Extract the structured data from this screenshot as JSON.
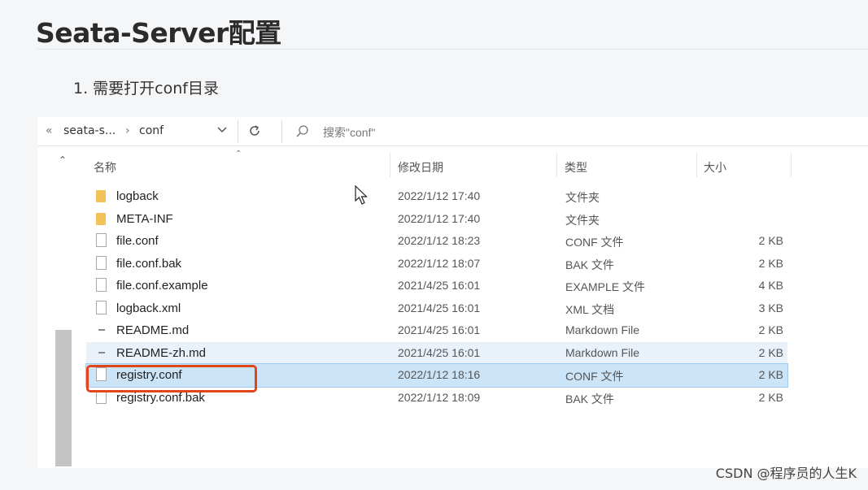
{
  "slide": {
    "title": "Seata-Server配置",
    "step": "1. 需要打开conf目录"
  },
  "explorer": {
    "breadcrumb": {
      "overflow": "«",
      "parent": "seata-s...",
      "separator": "›",
      "current": "conf"
    },
    "search": {
      "placeholder": "搜索\"conf\""
    },
    "columns": {
      "name": "名称",
      "date": "修改日期",
      "type": "类型",
      "size": "大小"
    },
    "files": [
      {
        "name": "logback",
        "date": "2022/1/12 17:40",
        "type": "文件夹",
        "size": "",
        "icon": "folder"
      },
      {
        "name": "META-INF",
        "date": "2022/1/12 17:40",
        "type": "文件夹",
        "size": "",
        "icon": "folder"
      },
      {
        "name": "file.conf",
        "date": "2022/1/12 18:23",
        "type": "CONF 文件",
        "size": "2 KB",
        "icon": "doc"
      },
      {
        "name": "file.conf.bak",
        "date": "2022/1/12 18:07",
        "type": "BAK 文件",
        "size": "2 KB",
        "icon": "doc"
      },
      {
        "name": "file.conf.example",
        "date": "2021/4/25 16:01",
        "type": "EXAMPLE 文件",
        "size": "4 KB",
        "icon": "doc"
      },
      {
        "name": "logback.xml",
        "date": "2021/4/25 16:01",
        "type": "XML 文档",
        "size": "3 KB",
        "icon": "doc"
      },
      {
        "name": "README.md",
        "date": "2021/4/25 16:01",
        "type": "Markdown File",
        "size": "2 KB",
        "icon": "md"
      },
      {
        "name": "README-zh.md",
        "date": "2021/4/25 16:01",
        "type": "Markdown File",
        "size": "2 KB",
        "icon": "md",
        "state": "hover"
      },
      {
        "name": "registry.conf",
        "date": "2022/1/12 18:16",
        "type": "CONF 文件",
        "size": "2 KB",
        "icon": "doc",
        "state": "selected"
      },
      {
        "name": "registry.conf.bak",
        "date": "2022/1/12 18:09",
        "type": "BAK 文件",
        "size": "2 KB",
        "icon": "doc"
      }
    ]
  },
  "colors": {
    "highlight": "#e0461c",
    "selected_row": "#cce4f7",
    "folder": "#f3c35a"
  },
  "watermark": "CSDN @程序员的人生K"
}
